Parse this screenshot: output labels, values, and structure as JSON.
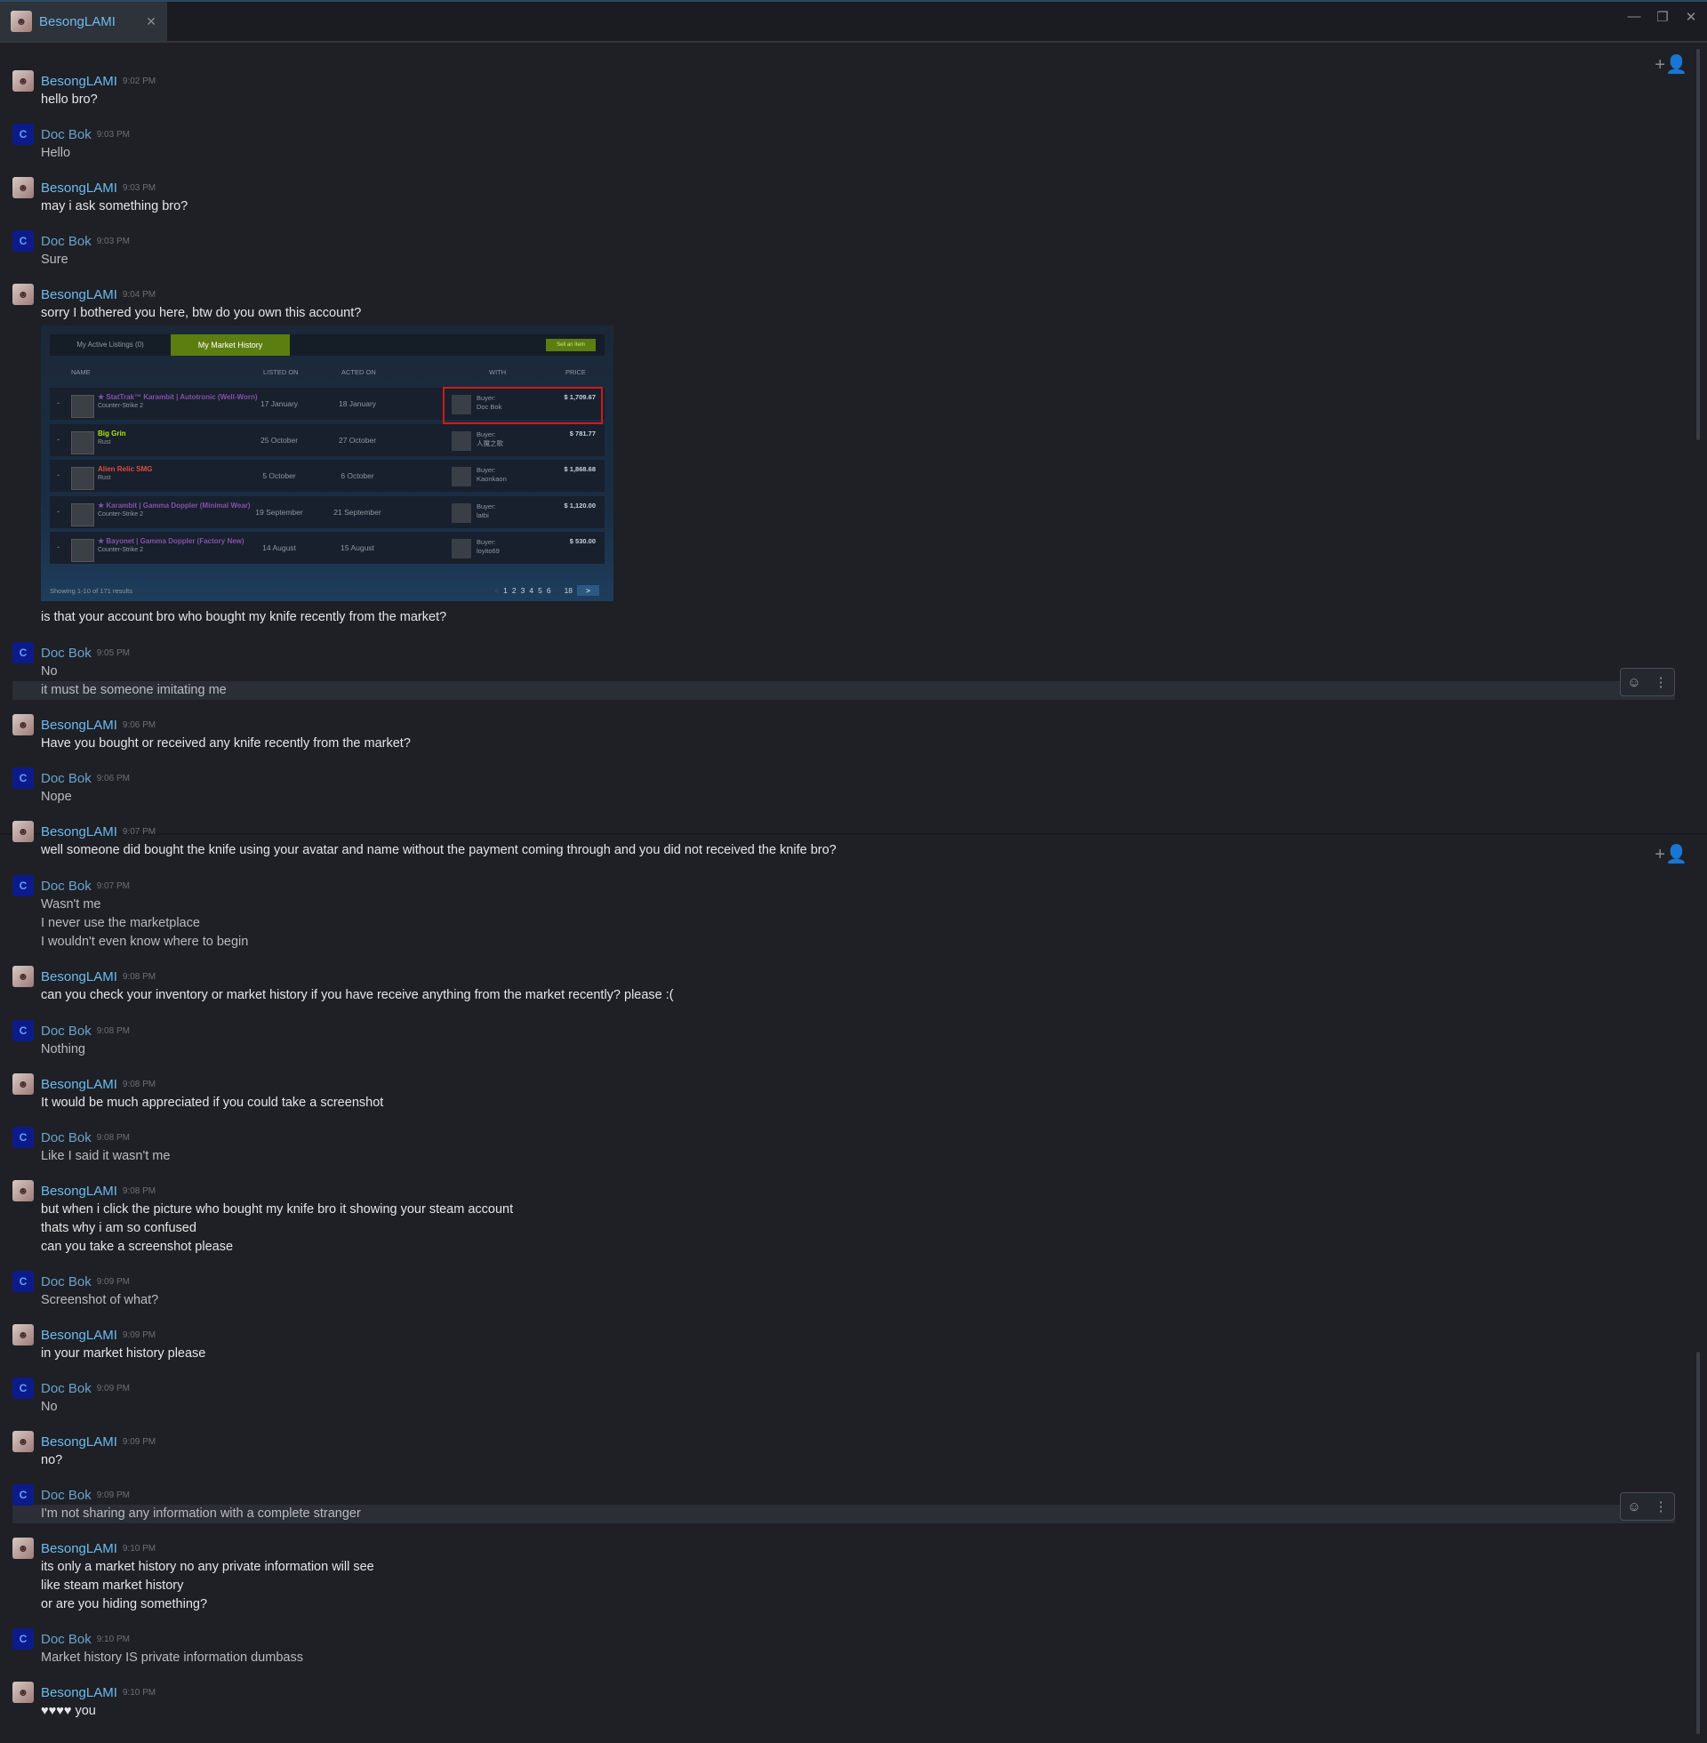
{
  "window": {
    "tab_title": "BesongLAMI",
    "tab_close": "✕",
    "minimize": "—",
    "restore": "❐",
    "close": "✕"
  },
  "colors": {
    "background": "#1e2025",
    "name_besong": "#6dbbf0",
    "name_doc": "#6aa3cf",
    "market_green": "#5c7e10",
    "highlight_red": "#d01a1a"
  },
  "icons": {
    "add_friend": "person-plus-icon",
    "emoji": "emoji-add-icon",
    "more": "more-vertical-icon"
  },
  "users": {
    "besong": "BesongLAMI",
    "doc": "Doc Bok"
  },
  "messages": [
    {
      "time": "9:02 PM",
      "lines": [
        "hello bro?"
      ]
    },
    {
      "time": "9:03 PM",
      "lines": [
        "Hello"
      ]
    },
    {
      "time": "9:03 PM",
      "lines": [
        "may i ask something bro?"
      ]
    },
    {
      "time": "9:03 PM",
      "lines": [
        "Sure"
      ]
    },
    {
      "time": "9:04 PM",
      "lines": [
        "sorry I bothered you here, btw do you own this account?"
      ],
      "after": "is that your account bro who bought my knife recently from the market?"
    },
    {
      "time": "9:05 PM",
      "lines": [
        "No",
        "it must be someone imitating me"
      ]
    },
    {
      "time": "9:06 PM",
      "lines": [
        "Have you bought or received any knife recently from the market?"
      ]
    },
    {
      "time": "9:06 PM",
      "lines": [
        "Nope"
      ]
    },
    {
      "time": "9:07 PM",
      "lines": [
        "well someone did bought the knife using your avatar and name without the payment coming through and you did not received the knife bro?"
      ]
    },
    {
      "time": "9:07 PM",
      "lines": [
        "Wasn't me",
        "I never use the marketplace",
        "I wouldn't even know where to begin"
      ]
    },
    {
      "time": "9:08 PM",
      "lines": [
        "can you check your inventory or market history if you have receive anything from the market recently? please :("
      ]
    },
    {
      "time": "9:08 PM",
      "lines": [
        "Nothing"
      ]
    },
    {
      "time": "9:08 PM",
      "lines": [
        "It would be much appreciated if you could take a screenshot"
      ]
    },
    {
      "time": "9:08 PM",
      "lines": [
        "Like I said it wasn't me"
      ]
    },
    {
      "time": "9:08 PM",
      "lines": [
        "but when i click the picture who bought my knife bro it showing your steam account",
        "thats why i am so confused",
        "can you take a screenshot please"
      ]
    },
    {
      "time": "9:09 PM",
      "lines": [
        "Screenshot of what?"
      ]
    },
    {
      "time": "9:09 PM",
      "lines": [
        "in your market history please"
      ]
    },
    {
      "time": "9:09 PM",
      "lines": [
        "No"
      ]
    },
    {
      "time": "9:09 PM",
      "lines": [
        "no?"
      ]
    },
    {
      "time": "9:09 PM",
      "lines": [
        "I'm not sharing any information with a complete stranger"
      ]
    },
    {
      "time": "9:10 PM",
      "lines": [
        "its only a market history no any private information will see",
        "like steam market history",
        "or are you hiding something?"
      ]
    },
    {
      "time": "9:10 PM",
      "lines": [
        "Market history IS private information dumbass"
      ]
    },
    {
      "time": "9:10 PM",
      "lines": [
        "♥♥♥♥ you"
      ]
    }
  ],
  "market_embed": {
    "tab_active_listings": "My Active Listings (0)",
    "tab_history": "My Market History",
    "sell_button": "Sell an Item",
    "columns": [
      "NAME",
      "LISTED ON",
      "ACTED ON",
      "WITH",
      "PRICE"
    ],
    "rows": [
      {
        "dash": "-",
        "name": "★ StatTrak™ Karambit | Autotronic (Well-Worn)",
        "game": "Counter-Strike 2",
        "listed": "17 January",
        "acted": "18 January",
        "buyer_label": "Buyer:",
        "buyer": "Doc Bok",
        "price": "$ 1,709.67",
        "color": "#8650ac"
      },
      {
        "dash": "-",
        "name": "Big Grin",
        "game": "Rust",
        "listed": "25 October",
        "acted": "27 October",
        "buyer_label": "Buyer:",
        "buyer": "人魔之歌",
        "price": "$ 781.77",
        "color": "#b2e600"
      },
      {
        "dash": "-",
        "name": "Alien Relic SMG",
        "game": "Rust",
        "listed": "5 October",
        "acted": "6 October",
        "buyer_label": "Buyer:",
        "buyer": "Kaonkaon",
        "price": "$ 1,868.68",
        "color": "#e34b3c"
      },
      {
        "dash": "-",
        "name": "★ Karambit | Gamma Doppler (Minimal Wear)",
        "game": "Counter-Strike 2",
        "listed": "19 September",
        "acted": "21 September",
        "buyer_label": "Buyer:",
        "buyer": "latbi",
        "price": "$ 1,120.00",
        "color": "#8650ac"
      },
      {
        "dash": "-",
        "name": "★ Bayonet | Gamma Doppler (Factory New)",
        "game": "Counter-Strike 2",
        "listed": "14 August",
        "acted": "15 August",
        "buyer_label": "Buyer:",
        "buyer": "loyito69",
        "price": "$ 530.00",
        "color": "#8650ac"
      }
    ],
    "footer": "Showing 1-10 of 171 results",
    "pages": [
      "<",
      "1",
      "2",
      "3",
      "4",
      "5",
      "6",
      "18",
      ">"
    ]
  }
}
